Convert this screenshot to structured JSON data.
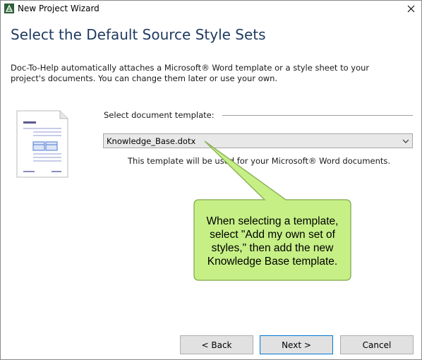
{
  "window": {
    "title": "New Project Wizard",
    "icons": {
      "app": "app-logo-icon",
      "close": "close-icon"
    }
  },
  "page": {
    "heading": "Select the Default Source Style Sets",
    "description": "Doc-To-Help automatically attaches a Microsoft® Word template or a style sheet to your project's documents. You can change them later or use your own."
  },
  "template_select": {
    "label": "Select document template:",
    "value": "Knowledge_Base.dotx",
    "hint": "This template will be used for your Microsoft® Word documents.",
    "arrow_icon": "chevron-down-icon"
  },
  "callout": {
    "text": "When selecting a template, select \"Add my own set of styles,\" then add the new Knowledge Base template.",
    "fill": "#c6f086",
    "border": "#8fb35a"
  },
  "buttons": {
    "back": "< Back",
    "next": "Next >",
    "cancel": "Cancel"
  },
  "colors": {
    "heading": "#1e3a5f",
    "accent": "#0078d7"
  }
}
